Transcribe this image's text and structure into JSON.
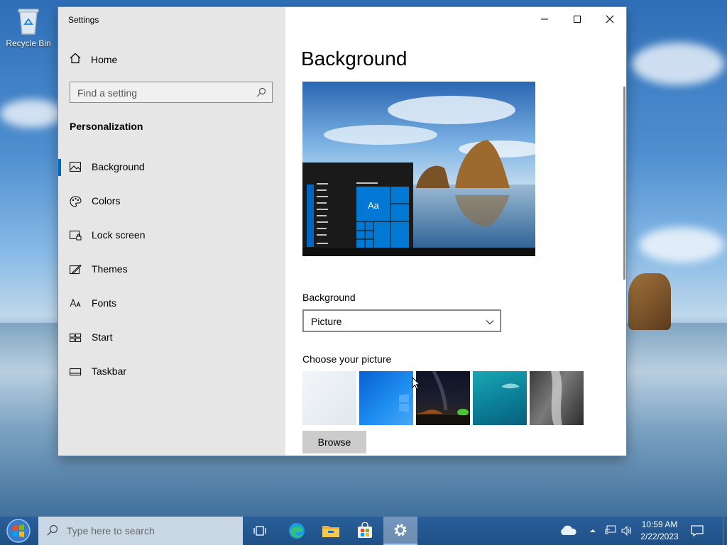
{
  "desktop": {
    "recycle_label": "Recycle Bin"
  },
  "window": {
    "title": "Settings",
    "controls": [
      "minimize",
      "maximize",
      "close"
    ]
  },
  "sidebar": {
    "home_label": "Home",
    "search_placeholder": "Find a setting",
    "section_title": "Personalization",
    "items": [
      {
        "label": "Background",
        "icon": "picture-icon",
        "selected": true
      },
      {
        "label": "Colors",
        "icon": "palette-icon",
        "selected": false
      },
      {
        "label": "Lock screen",
        "icon": "lock-screen-icon",
        "selected": false
      },
      {
        "label": "Themes",
        "icon": "themes-icon",
        "selected": false
      },
      {
        "label": "Fonts",
        "icon": "fonts-icon",
        "selected": false
      },
      {
        "label": "Start",
        "icon": "start-icon",
        "selected": false
      },
      {
        "label": "Taskbar",
        "icon": "taskbar-icon",
        "selected": false
      }
    ]
  },
  "main": {
    "title": "Background",
    "preview_sample_text": "Aa",
    "background_label": "Background",
    "background_value": "Picture",
    "choose_label": "Choose your picture",
    "browse_label": "Browse"
  },
  "taskbar": {
    "search_placeholder": "Type here to search",
    "time": "10:59 AM",
    "date": "2/22/2023"
  },
  "colors": {
    "accent": "#0067c0",
    "sidebar_bg": "#e6e6e6",
    "taskbar": "#1f4f86"
  }
}
